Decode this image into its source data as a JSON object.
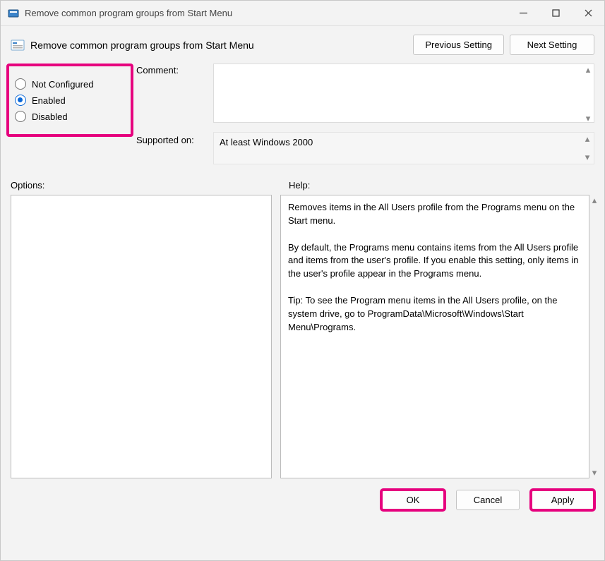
{
  "window": {
    "title": "Remove common program groups from Start Menu"
  },
  "header": {
    "policy_title": "Remove common program groups from Start Menu",
    "prev_label": "Previous Setting",
    "next_label": "Next Setting"
  },
  "state": {
    "not_configured_label": "Not Configured",
    "enabled_label": "Enabled",
    "disabled_label": "Disabled",
    "selected": "enabled"
  },
  "comment": {
    "label": "Comment:",
    "value": ""
  },
  "supported": {
    "label": "Supported on:",
    "value": "At least Windows 2000"
  },
  "labels": {
    "options": "Options:",
    "help": "Help:"
  },
  "help": {
    "p1": "Removes items in the All Users profile from the Programs menu on the Start menu.",
    "p2": "By default, the Programs menu contains items from the All Users profile and items from the user's profile. If you enable this setting, only items in the user's profile appear in the Programs menu.",
    "p3": "Tip: To see the Program menu items in the All Users profile, on the system drive, go to ProgramData\\Microsoft\\Windows\\Start Menu\\Programs."
  },
  "footer": {
    "ok": "OK",
    "cancel": "Cancel",
    "apply": "Apply"
  }
}
